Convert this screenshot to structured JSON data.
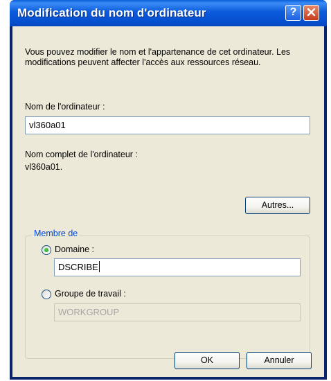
{
  "window": {
    "title": "Modification du nom d'ordinateur",
    "help_icon": "help-icon",
    "close_icon": "close-icon"
  },
  "description": "Vous pouvez modifier le nom et l'appartenance de cet ordinateur. Les modifications peuvent affecter l'accès aux ressources réseau.",
  "computer_name": {
    "label": "Nom de l'ordinateur :",
    "value": "vl360a01"
  },
  "full_name": {
    "label": "Nom complet de l'ordinateur :",
    "value": "vl360a01."
  },
  "buttons": {
    "more": "Autres...",
    "ok": "OK",
    "cancel": "Annuler"
  },
  "member_of": {
    "title": "Membre de",
    "domain": {
      "label": "Domaine :",
      "value": "DSCRIBE",
      "selected": true
    },
    "workgroup": {
      "label": "Groupe de travail :",
      "value": "WORKGROUP",
      "selected": false
    }
  },
  "colors": {
    "titlebar": "#0b5bdc",
    "dialog_bg": "#ece9d8",
    "group_title": "#0046d5",
    "close_button": "#c63b1c"
  }
}
